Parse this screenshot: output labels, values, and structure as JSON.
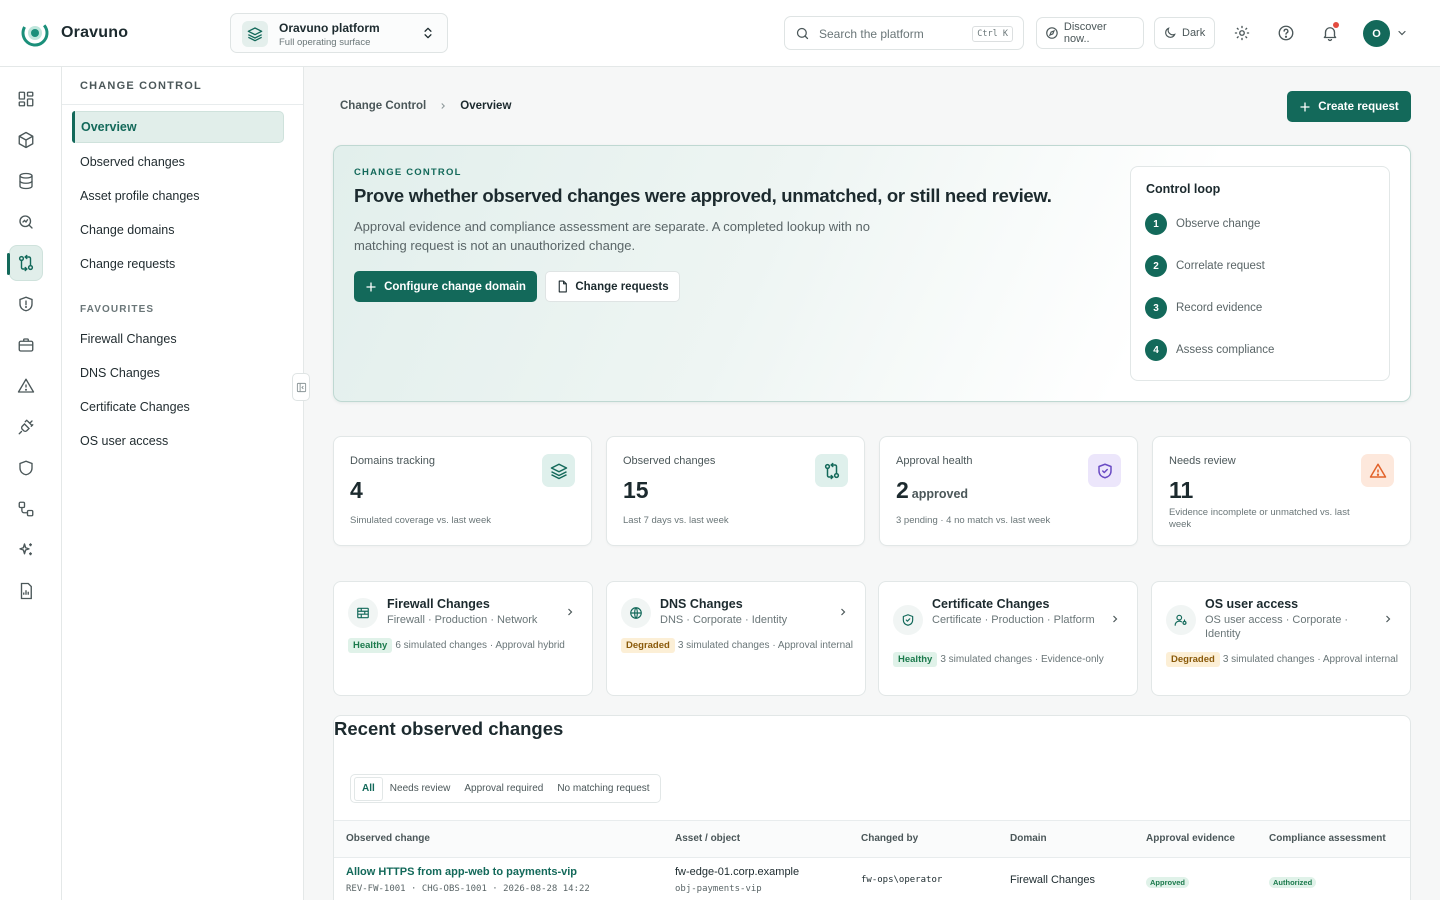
{
  "app": {
    "name": "Oravuno"
  },
  "workspace": {
    "title": "Oravuno platform",
    "subtitle": "Full operating surface"
  },
  "topbar": {
    "search_placeholder": "Search the platform",
    "search_shortcut": "Ctrl K",
    "discover_label": "Discover now..",
    "theme_label": "Dark",
    "avatar_initial": "O"
  },
  "rail": {
    "icons": [
      "dashboard-icon",
      "cube-icon",
      "database-icon",
      "search-insight-icon",
      "git-compare-icon",
      "shield-alert-icon",
      "briefcase-icon",
      "warning-icon",
      "plug-icon",
      "shield-icon",
      "workflow-icon",
      "sparkles-icon",
      "report-icon"
    ],
    "active": "git-compare-icon"
  },
  "sidebar": {
    "heading": "CHANGE CONTROL",
    "items": [
      {
        "label": "Overview",
        "active": true
      },
      {
        "label": "Observed changes"
      },
      {
        "label": "Asset profile changes"
      },
      {
        "label": "Change domains"
      },
      {
        "label": "Change requests"
      }
    ],
    "favourites_heading": "FAVOURITES",
    "favourites": [
      {
        "label": "Firewall Changes"
      },
      {
        "label": "DNS Changes"
      },
      {
        "label": "Certificate Changes"
      },
      {
        "label": "OS user access"
      }
    ]
  },
  "breadcrumb": {
    "parent": "Change Control",
    "current": "Overview"
  },
  "actions": {
    "create_request": "Create request"
  },
  "hero": {
    "eyebrow": "CHANGE CONTROL",
    "title": "Prove whether observed changes were approved, unmatched, or still need review.",
    "description": "Approval evidence and compliance assessment are separate. A completed lookup with no matching request is not an unauthorized change.",
    "primary_button": "Configure change domain",
    "secondary_button": "Change requests",
    "loop": {
      "title": "Control loop",
      "steps": [
        {
          "num": "1",
          "label": "Observe change"
        },
        {
          "num": "2",
          "label": "Correlate request"
        },
        {
          "num": "3",
          "label": "Record evidence"
        },
        {
          "num": "4",
          "label": "Assess compliance"
        }
      ]
    }
  },
  "stats": [
    {
      "label": "Domains tracking",
      "value": "4",
      "unit": "",
      "sub": "Simulated coverage vs. last week",
      "icon": "layers-icon",
      "icon_bg": "#dff0ec",
      "icon_color": "#13695a"
    },
    {
      "label": "Observed changes",
      "value": "15",
      "unit": "",
      "sub": "Last 7 days vs. last week",
      "icon": "git-compare-icon",
      "icon_bg": "#dff0ec",
      "icon_color": "#13695a"
    },
    {
      "label": "Approval health",
      "value": "2",
      "unit": "approved",
      "sub": "3 pending · 4 no match vs. last week",
      "icon": "shield-check-icon",
      "icon_bg": "#ece6fb",
      "icon_color": "#6a4bc4"
    },
    {
      "label": "Needs review",
      "value": "11",
      "unit": "",
      "sub": "Evidence incomplete or unmatched vs. last week",
      "icon": "warning-icon",
      "icon_bg": "#fde8dc",
      "icon_color": "#e2622a"
    }
  ],
  "domains": [
    {
      "title": "Firewall Changes",
      "meta": "Firewall · Production · Network",
      "status": "Healthy",
      "status_type": "healthy",
      "detail": "6 simulated changes · Approval hybrid",
      "icon": "firewall-icon"
    },
    {
      "title": "DNS Changes",
      "meta": "DNS · Corporate · Identity",
      "status": "Degraded",
      "status_type": "degraded",
      "detail": "3 simulated changes · Approval internal",
      "icon": "globe-icon"
    },
    {
      "title": "Certificate Changes",
      "meta": "Certificate · Production · Platform",
      "status": "Healthy",
      "status_type": "healthy",
      "detail": "3 simulated changes · Evidence-only",
      "icon": "shield-icon"
    },
    {
      "title": "OS user access",
      "meta": "OS user access · Corporate · Identity",
      "status": "Degraded",
      "status_type": "degraded",
      "detail": "3 simulated changes · Approval internal",
      "icon": "user-key-icon"
    }
  ],
  "recent": {
    "title": "Recent observed changes",
    "tabs": [
      "All",
      "Needs review",
      "Approval required",
      "No matching request"
    ],
    "active_tab": "All",
    "columns": [
      "Observed change",
      "Asset / object",
      "Changed by",
      "Domain",
      "Approval evidence",
      "Compliance assessment"
    ],
    "rows": [
      {
        "change": "Allow HTTPS from app-web to payments-vip",
        "change_meta": "REV-FW-1001 · CHG-OBS-1001 · 2026-08-28 14:22",
        "asset": "fw-edge-01.corp.example",
        "object": "obj-payments-vip",
        "changed_by": "fw-ops\\operator",
        "domain": "Firewall Changes",
        "approval": "Approved",
        "compliance": "Authorized"
      }
    ]
  }
}
